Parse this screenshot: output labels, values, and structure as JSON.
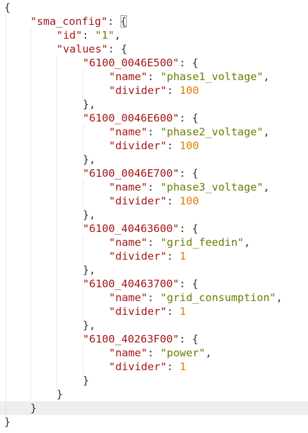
{
  "editor": {
    "colors": {
      "key": "#a31515",
      "string": "#6a7d00",
      "number": "#e07b00",
      "punctuation": "#333333",
      "current_line": "#eeeeee",
      "indent_guide": "#d4d4d4"
    },
    "lines": [
      {
        "tokens": [
          {
            "t": "p",
            "v": "{"
          }
        ]
      },
      {
        "tokens": [
          {
            "t": "k",
            "v": "\"sma_config\""
          },
          {
            "t": "p",
            "v": ": "
          },
          {
            "t": "p",
            "v": "{",
            "match": true
          }
        ]
      },
      {
        "tokens": [
          {
            "t": "k",
            "v": "\"id\""
          },
          {
            "t": "p",
            "v": ": "
          },
          {
            "t": "s",
            "v": "\"1\""
          },
          {
            "t": "p",
            "v": ","
          }
        ]
      },
      {
        "tokens": [
          {
            "t": "k",
            "v": "\"values\""
          },
          {
            "t": "p",
            "v": ": {"
          }
        ]
      },
      {
        "tokens": [
          {
            "t": "k",
            "v": "\"6100_0046E500\""
          },
          {
            "t": "p",
            "v": ": {"
          }
        ]
      },
      {
        "tokens": [
          {
            "t": "k",
            "v": "\"name\""
          },
          {
            "t": "p",
            "v": ": "
          },
          {
            "t": "s",
            "v": "\"phase1_voltage\""
          },
          {
            "t": "p",
            "v": ","
          }
        ]
      },
      {
        "tokens": [
          {
            "t": "k",
            "v": "\"divider\""
          },
          {
            "t": "p",
            "v": ": "
          },
          {
            "t": "n",
            "v": "100"
          }
        ]
      },
      {
        "tokens": [
          {
            "t": "p",
            "v": "},"
          }
        ]
      },
      {
        "tokens": [
          {
            "t": "k",
            "v": "\"6100_0046E600\""
          },
          {
            "t": "p",
            "v": ": {"
          }
        ]
      },
      {
        "tokens": [
          {
            "t": "k",
            "v": "\"name\""
          },
          {
            "t": "p",
            "v": ": "
          },
          {
            "t": "s",
            "v": "\"phase2_voltage\""
          },
          {
            "t": "p",
            "v": ","
          }
        ]
      },
      {
        "tokens": [
          {
            "t": "k",
            "v": "\"divider\""
          },
          {
            "t": "p",
            "v": ": "
          },
          {
            "t": "n",
            "v": "100"
          }
        ]
      },
      {
        "tokens": [
          {
            "t": "p",
            "v": "},"
          }
        ]
      },
      {
        "tokens": [
          {
            "t": "k",
            "v": "\"6100_0046E700\""
          },
          {
            "t": "p",
            "v": ": {"
          }
        ]
      },
      {
        "tokens": [
          {
            "t": "k",
            "v": "\"name\""
          },
          {
            "t": "p",
            "v": ": "
          },
          {
            "t": "s",
            "v": "\"phase3_voltage\""
          },
          {
            "t": "p",
            "v": ","
          }
        ]
      },
      {
        "tokens": [
          {
            "t": "k",
            "v": "\"divider\""
          },
          {
            "t": "p",
            "v": ": "
          },
          {
            "t": "n",
            "v": "100"
          }
        ]
      },
      {
        "tokens": [
          {
            "t": "p",
            "v": "},"
          }
        ]
      },
      {
        "tokens": [
          {
            "t": "k",
            "v": "\"6100_40463600\""
          },
          {
            "t": "p",
            "v": ": {"
          }
        ]
      },
      {
        "tokens": [
          {
            "t": "k",
            "v": "\"name\""
          },
          {
            "t": "p",
            "v": ": "
          },
          {
            "t": "s",
            "v": "\"grid_feedin\""
          },
          {
            "t": "p",
            "v": ","
          }
        ]
      },
      {
        "tokens": [
          {
            "t": "k",
            "v": "\"divider\""
          },
          {
            "t": "p",
            "v": ": "
          },
          {
            "t": "n",
            "v": "1"
          }
        ]
      },
      {
        "tokens": [
          {
            "t": "p",
            "v": "},"
          }
        ]
      },
      {
        "tokens": [
          {
            "t": "k",
            "v": "\"6100_40463700\""
          },
          {
            "t": "p",
            "v": ": {"
          }
        ]
      },
      {
        "tokens": [
          {
            "t": "k",
            "v": "\"name\""
          },
          {
            "t": "p",
            "v": ": "
          },
          {
            "t": "s",
            "v": "\"grid_consumption\""
          },
          {
            "t": "p",
            "v": ","
          }
        ]
      },
      {
        "tokens": [
          {
            "t": "k",
            "v": "\"divider\""
          },
          {
            "t": "p",
            "v": ": "
          },
          {
            "t": "n",
            "v": "1"
          }
        ]
      },
      {
        "tokens": [
          {
            "t": "p",
            "v": "},"
          }
        ]
      },
      {
        "tokens": [
          {
            "t": "k",
            "v": "\"6100_40263F00\""
          },
          {
            "t": "p",
            "v": ": {"
          }
        ]
      },
      {
        "tokens": [
          {
            "t": "k",
            "v": "\"name\""
          },
          {
            "t": "p",
            "v": ": "
          },
          {
            "t": "s",
            "v": "\"power\""
          },
          {
            "t": "p",
            "v": ","
          }
        ]
      },
      {
        "tokens": [
          {
            "t": "k",
            "v": "\"divider\""
          },
          {
            "t": "p",
            "v": ": "
          },
          {
            "t": "n",
            "v": "1"
          }
        ]
      },
      {
        "tokens": [
          {
            "t": "p",
            "v": "}"
          }
        ]
      },
      {
        "tokens": [
          {
            "t": "p",
            "v": "}"
          }
        ]
      },
      {
        "tokens": [
          {
            "t": "p",
            "v": "}"
          }
        ],
        "current": true
      },
      {
        "tokens": [
          {
            "t": "p",
            "v": "}"
          }
        ]
      }
    ]
  }
}
